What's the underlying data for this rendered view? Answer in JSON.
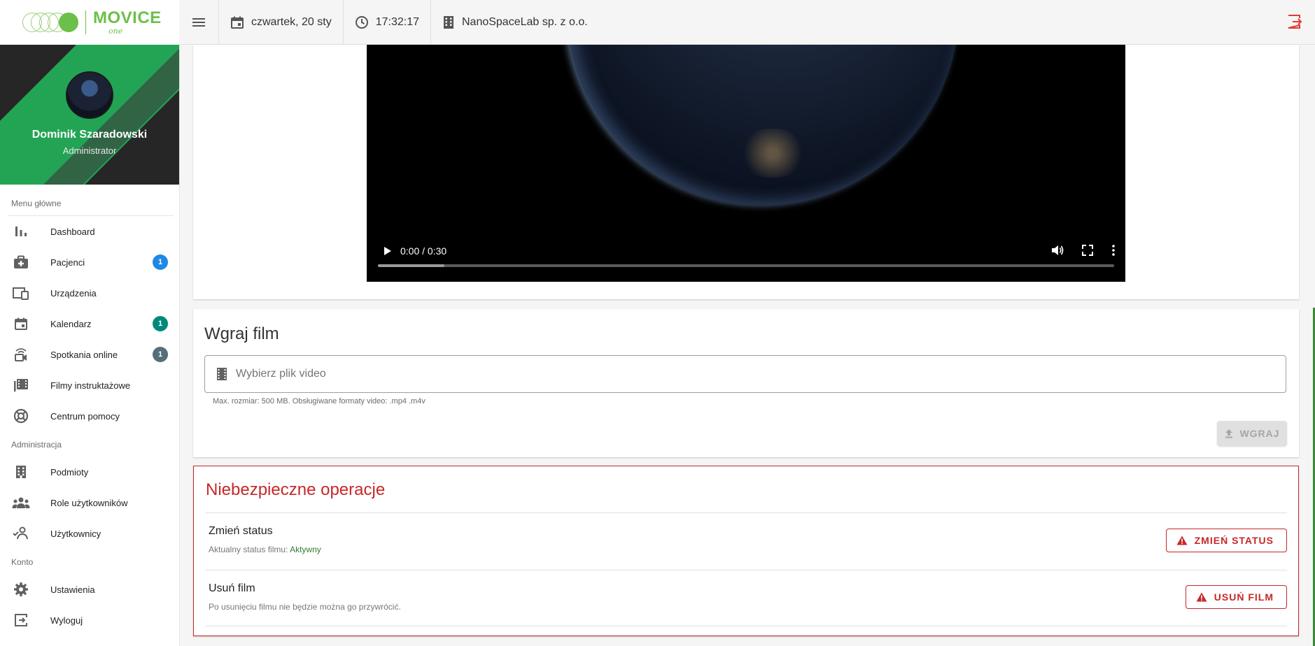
{
  "logo": {
    "main": "MOVICE",
    "sub": "one"
  },
  "profile": {
    "name": "Dominik Szaradowski",
    "role": "Administrator"
  },
  "nav": {
    "main_title": "Menu główne",
    "admin_title": "Administracja",
    "account_title": "Konto",
    "main_items": [
      {
        "label": "Dashboard",
        "icon": "bar-chart-icon"
      },
      {
        "label": "Pacjenci",
        "icon": "medical-bag-icon",
        "badge": "1",
        "badge_color": "#1e88e5"
      },
      {
        "label": "Urządzenia",
        "icon": "devices-icon"
      },
      {
        "label": "Kalendarz",
        "icon": "calendar-icon",
        "badge": "1",
        "badge_color": "#00897b"
      },
      {
        "label": "Spotkania online",
        "icon": "video-call-icon",
        "badge": "1",
        "badge_color": "#546e7a"
      },
      {
        "label": "Filmy instruktażowe",
        "icon": "video-library-icon"
      },
      {
        "label": "Centrum pomocy",
        "icon": "lifebuoy-icon"
      }
    ],
    "admin_items": [
      {
        "label": "Podmioty",
        "icon": "building-icon"
      },
      {
        "label": "Role użytkowników",
        "icon": "group-icon"
      },
      {
        "label": "Użytkownicy",
        "icon": "user-check-icon"
      }
    ],
    "account_items": [
      {
        "label": "Ustawienia",
        "icon": "gear-icon"
      },
      {
        "label": "Wyloguj",
        "icon": "logout-icon"
      }
    ]
  },
  "topbar": {
    "date": "czwartek, 20 sty",
    "time": "17:32:17",
    "organization": "NanoSpaceLab sp. z o.o."
  },
  "video": {
    "time_display": "0:00 / 0:30",
    "progress": 0.09
  },
  "upload": {
    "title": "Wgraj film",
    "file_placeholder": "Wybierz plik video",
    "hint": "Max. rozmiar: 500 MB. Obsługiwane formaty video: .mp4 .m4v",
    "button_label": "WGRAJ"
  },
  "danger": {
    "title": "Niebezpieczne operacje",
    "status": {
      "title": "Zmień status",
      "desc_prefix": "Aktualny status filmu:",
      "value": "Aktywny",
      "button_label": "ZMIEŃ STATUS"
    },
    "delete": {
      "title": "Usuń film",
      "desc": "Po usunięciu filmu nie będzie można go przywrócić.",
      "button_label": "USUŃ FILM"
    }
  },
  "colors": {
    "brand_green": "#6cc04a",
    "danger_red": "#c62828",
    "status_green": "#2e7d32"
  }
}
